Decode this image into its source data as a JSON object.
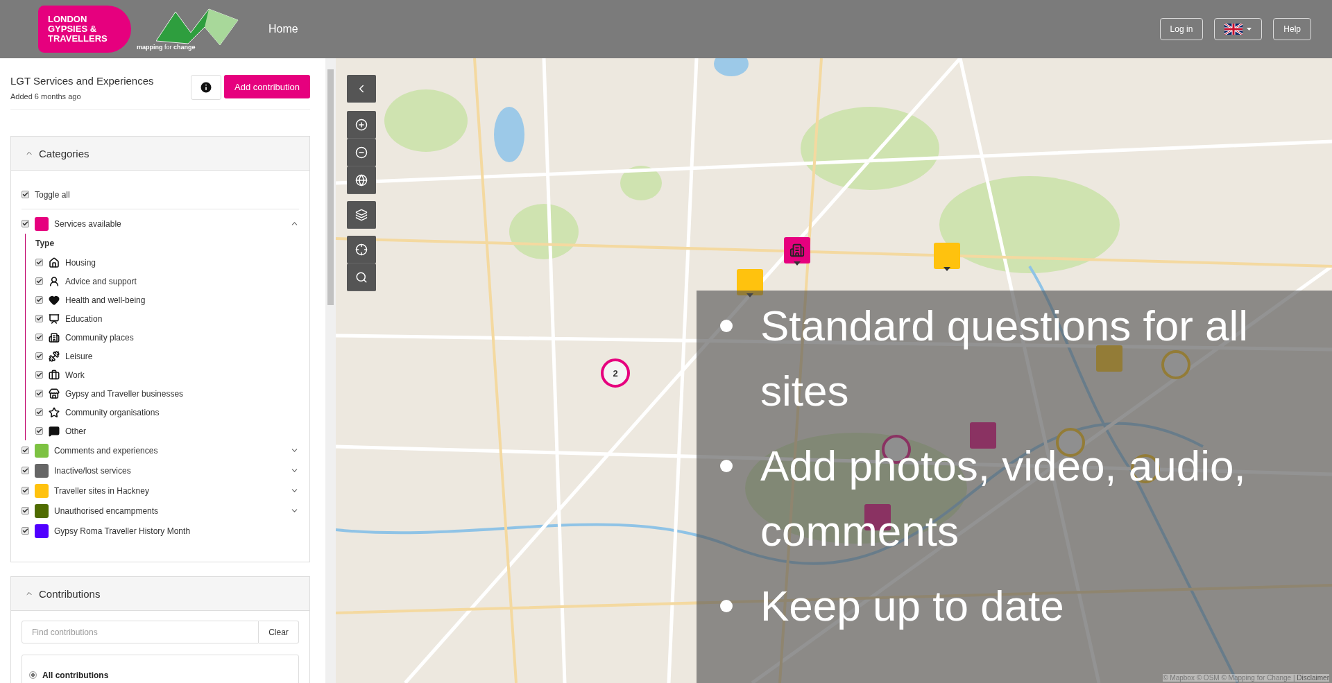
{
  "header": {
    "logo_lines": [
      "LONDON",
      "GYPSIES &",
      "TRAVELLERS"
    ],
    "partner_logo": {
      "word1": "mapping",
      "word2": "for",
      "word3": "change"
    },
    "nav": [
      "Home"
    ],
    "buttons": [
      {
        "kind": "text",
        "label": "Log in"
      },
      {
        "kind": "language"
      },
      {
        "kind": "text",
        "label": "Help"
      }
    ]
  },
  "sidebar": {
    "title": "LGT Services and Experiences",
    "subtitle": "Added 6 months ago",
    "add_button": "Add contribution",
    "categories_panel": {
      "title": "Categories",
      "expanded": true,
      "toggle_all": {
        "label": "Toggle all",
        "checked": true
      },
      "items": [
        {
          "label": "Services available",
          "color": "#e6007e",
          "checked": true,
          "expanded": true,
          "heading": "Type",
          "types": [
            {
              "kind": "housing",
              "label": "Housing",
              "checked": true
            },
            {
              "kind": "advice",
              "label": "Advice and support",
              "checked": true
            },
            {
              "kind": "health",
              "label": "Health and well-being",
              "checked": true
            },
            {
              "kind": "education",
              "label": "Education",
              "checked": true
            },
            {
              "kind": "community",
              "label": "Community places",
              "checked": true
            },
            {
              "kind": "leisure",
              "label": "Leisure",
              "checked": true
            },
            {
              "kind": "work",
              "label": "Work",
              "checked": true
            },
            {
              "kind": "business",
              "label": "Gypsy and Traveller businesses",
              "checked": true
            },
            {
              "kind": "organisation",
              "label": "Community organisations",
              "checked": true
            },
            {
              "kind": "other",
              "label": "Other",
              "checked": true
            }
          ]
        },
        {
          "label": "Comments and experiences",
          "color": "#7dc242",
          "checked": true,
          "expanded": false
        },
        {
          "label": "Inactive/lost services",
          "color": "#666666",
          "checked": true,
          "expanded": false
        },
        {
          "label": "Traveller sites in Hackney",
          "color": "#ffc20e",
          "checked": true,
          "expanded": false
        },
        {
          "label": "Unauthorised encampments",
          "color": "#4f6b00",
          "checked": true,
          "expanded": false
        },
        {
          "label": "Gypsy Roma Traveller History Month",
          "color": "#5000ff",
          "checked": true
        }
      ]
    },
    "contributions_panel": {
      "title": "Contributions",
      "expanded": true,
      "search": {
        "placeholder": "Find contributions"
      },
      "clear_button": "Clear",
      "filters": [
        {
          "label": "All contributions",
          "selected": true
        }
      ]
    }
  },
  "map": {
    "markers": [
      {
        "kind": "community",
        "color": "#e6007e"
      },
      {
        "kind": "plain",
        "color": "#ffc20e"
      },
      {
        "kind": "plain",
        "color": "#ffc20e"
      },
      {
        "kind": "cluster",
        "color": "#e6007e",
        "count": "2"
      }
    ],
    "attribution": {
      "text": "© Mapbox © OSM © Mapping for Change | ",
      "link": "Disclaimer"
    }
  },
  "slide_overlay": {
    "bullets": [
      "Standard questions for all sites",
      "Add photos, video, audio, comments",
      "Keep up to date"
    ]
  }
}
